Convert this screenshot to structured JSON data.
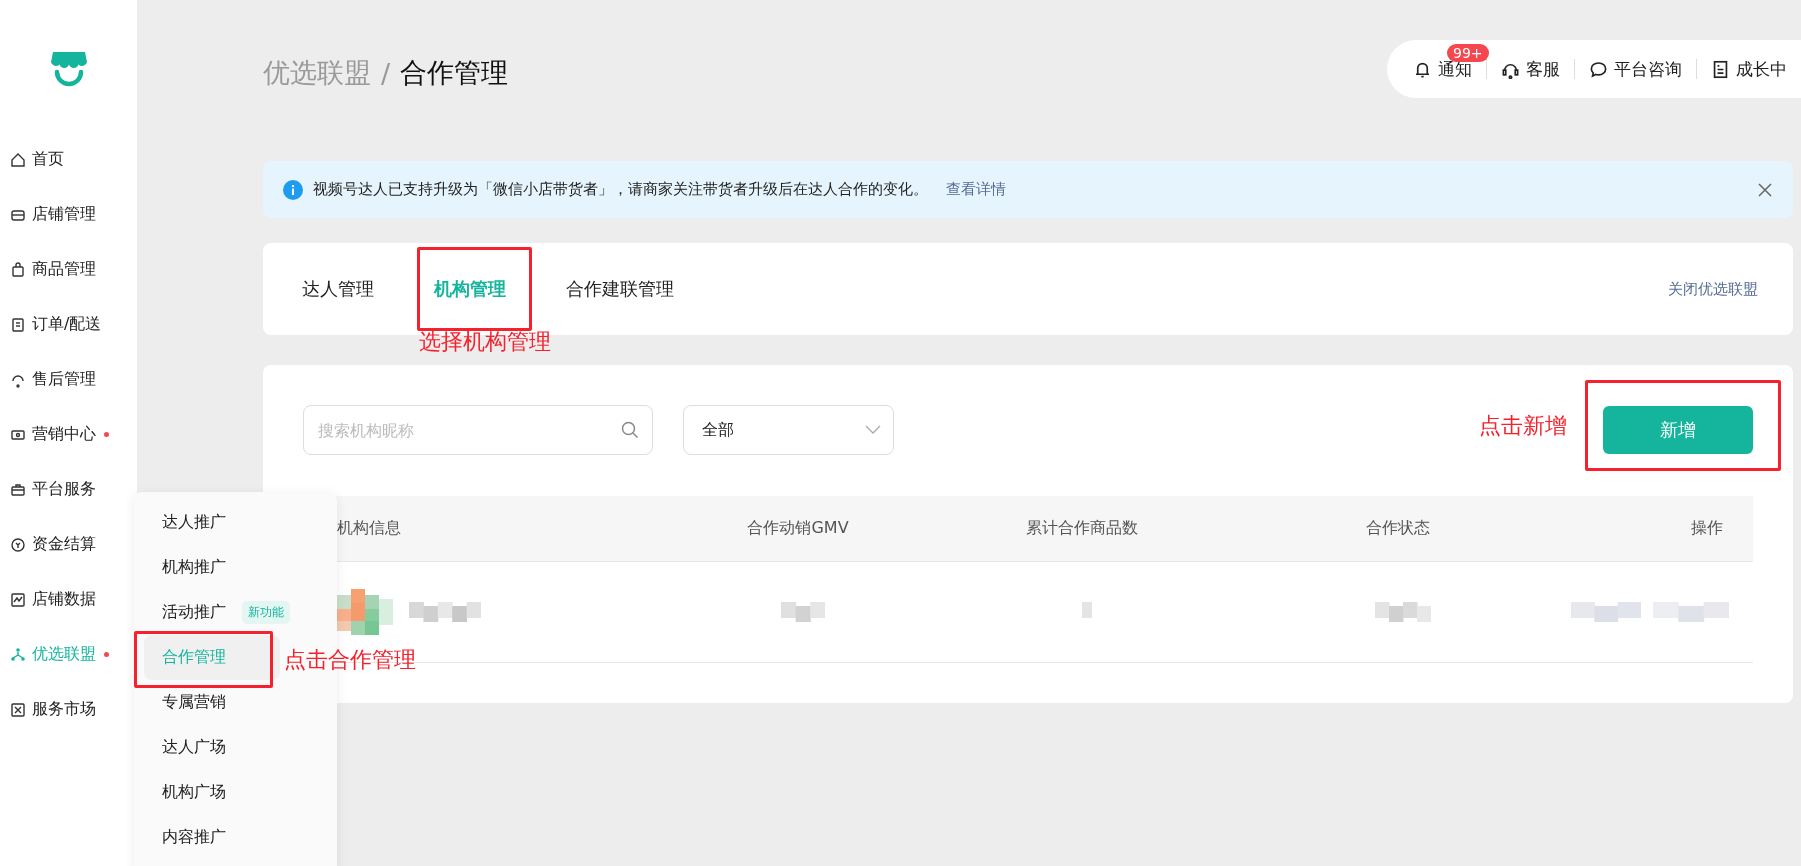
{
  "sidebar": {
    "items": [
      {
        "label": "首页",
        "selected": false,
        "dot": false
      },
      {
        "label": "店铺管理",
        "selected": false,
        "dot": false
      },
      {
        "label": "商品管理",
        "selected": false,
        "dot": false
      },
      {
        "label": "订单/配送",
        "selected": false,
        "dot": false
      },
      {
        "label": "售后管理",
        "selected": false,
        "dot": false
      },
      {
        "label": "营销中心",
        "selected": false,
        "dot": true
      },
      {
        "label": "平台服务",
        "selected": false,
        "dot": false
      },
      {
        "label": "资金结算",
        "selected": false,
        "dot": false
      },
      {
        "label": "店铺数据",
        "selected": false,
        "dot": false
      },
      {
        "label": "优选联盟",
        "selected": true,
        "dot": true
      },
      {
        "label": "服务市场",
        "selected": false,
        "dot": false
      }
    ]
  },
  "submenu": {
    "items": [
      {
        "label": "达人推广",
        "selected": false,
        "highlighted": false
      },
      {
        "label": "机构推广",
        "selected": false,
        "highlighted": false
      },
      {
        "label": "活动推广",
        "selected": false,
        "highlighted": false,
        "badge": "新功能"
      },
      {
        "label": "合作管理",
        "selected": true,
        "highlighted": true
      },
      {
        "label": "专属营销",
        "selected": false,
        "highlighted": false
      },
      {
        "label": "达人广场",
        "selected": false,
        "highlighted": false
      },
      {
        "label": "机构广场",
        "selected": false,
        "highlighted": false
      },
      {
        "label": "内容推广",
        "selected": false,
        "highlighted": false
      }
    ],
    "annotation": "点击合作管理"
  },
  "breadcrumb": {
    "parent": "优选联盟",
    "separator": "/",
    "current": "合作管理"
  },
  "top_bar": {
    "items": [
      {
        "label": "通知",
        "badge": "99+"
      },
      {
        "label": "客服"
      },
      {
        "label": "平台咨询"
      },
      {
        "label": "成长中"
      }
    ]
  },
  "notice": {
    "text": "视频号达人已支持升级为「微信小店带货者」，请商家关注带货者升级后在达人合作的变化。",
    "link": "查看详情"
  },
  "tabs": {
    "items": [
      {
        "label": "达人管理",
        "selected": false,
        "highlighted": false
      },
      {
        "label": "机构管理",
        "selected": true,
        "highlighted": true
      },
      {
        "label": "合作建联管理",
        "selected": false,
        "highlighted": false
      }
    ],
    "annotation": "选择机构管理",
    "action": "关闭优选联盟"
  },
  "filters": {
    "search": {
      "placeholder": "搜索机构昵称"
    },
    "select": {
      "value": "全部"
    }
  },
  "add_button": {
    "label": "新增",
    "highlighted": true,
    "annotation": "点击新增"
  },
  "table": {
    "columns": [
      "机构信息",
      "合作动销GMV",
      "累计合作商品数",
      "合作状态",
      "操作"
    ],
    "rows": [
      {
        "blurred": true
      }
    ]
  }
}
